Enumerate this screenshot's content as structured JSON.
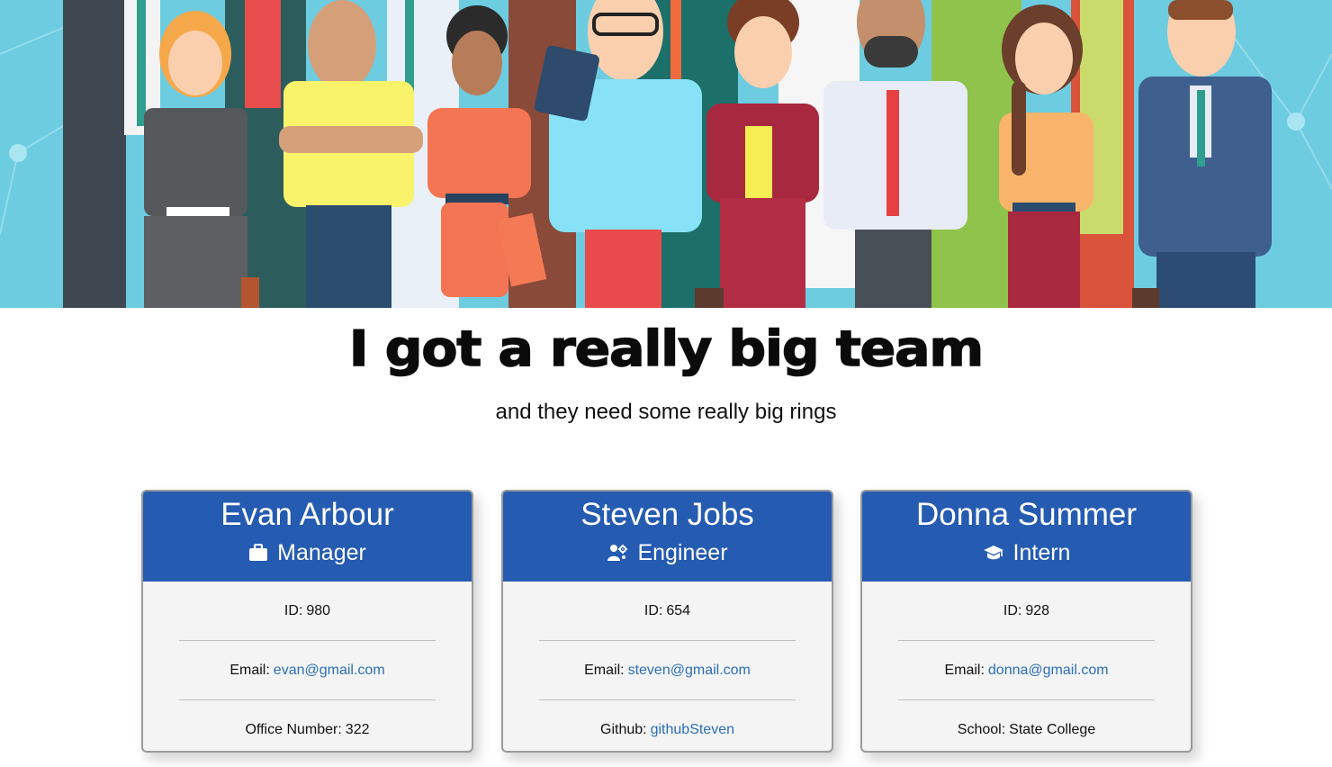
{
  "header": {
    "title": "I got a really big team",
    "subtitle": "and they need some really big rings"
  },
  "colors": {
    "banner_bg": "#6dcce0",
    "card_header": "#255bb1",
    "link": "#2a6fb5"
  },
  "team": [
    {
      "name": "Evan Arbour",
      "role": "Manager",
      "icon": "briefcase-icon",
      "id_label": "ID:",
      "id": "980",
      "email_label": "Email:",
      "email": "evan@gmail.com",
      "extra_label": "Office Number:",
      "extra_value": "322"
    },
    {
      "name": "Steven Jobs",
      "role": "Engineer",
      "icon": "user-gear-icon",
      "id_label": "ID:",
      "id": "654",
      "email_label": "Email:",
      "email": "steven@gmail.com",
      "extra_label": "Github:",
      "extra_value": "githubSteven"
    },
    {
      "name": "Donna Summer",
      "role": "Intern",
      "icon": "graduation-cap-icon",
      "id_label": "ID:",
      "id": "928",
      "email_label": "Email:",
      "email": "donna@gmail.com",
      "extra_label": "School:",
      "extra_value": "State College"
    }
  ]
}
